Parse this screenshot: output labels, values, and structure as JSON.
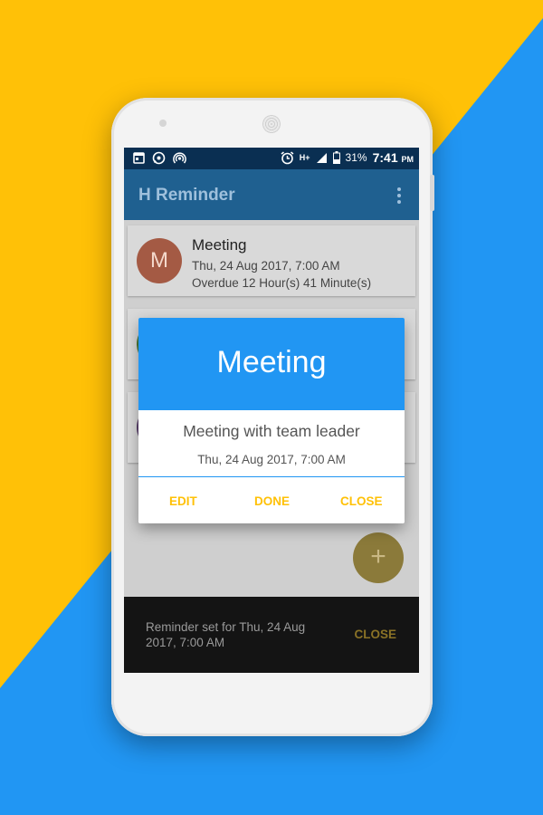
{
  "status_bar": {
    "battery": "31%",
    "time": "7:41",
    "ampm": "PM",
    "network": "H+"
  },
  "app": {
    "title": "H Reminder"
  },
  "reminders": [
    {
      "initial": "M",
      "title": "Meeting",
      "date": "Thu, 24 Aug 2017, 7:00 AM",
      "status": "Overdue 12 Hour(s) 41 Minute(s)",
      "color": "#a45a44"
    },
    {
      "color": "#4a7a3a"
    },
    {
      "color": "#5a3f6c"
    }
  ],
  "dialog": {
    "title": "Meeting",
    "description": "Meeting with team leader",
    "date": "Thu, 24 Aug 2017, 7:00 AM",
    "buttons": {
      "edit": "EDIT",
      "done": "DONE",
      "close": "CLOSE"
    }
  },
  "fab": {
    "label": "+"
  },
  "snackbar": {
    "text": "Reminder set for Thu, 24 Aug 2017, 7:00 AM",
    "action": "CLOSE"
  },
  "colors": {
    "accent": "#FFC107",
    "primary": "#2196F3",
    "toolbar": "#1f6090"
  }
}
